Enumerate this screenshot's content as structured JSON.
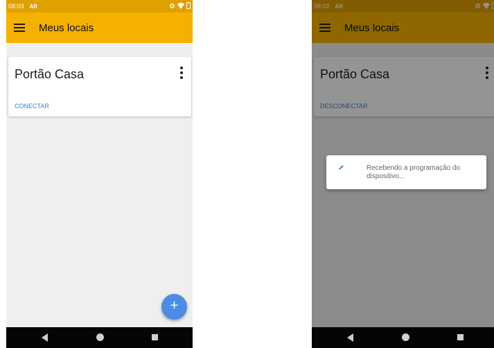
{
  "screens": {
    "left": {
      "status": {
        "time": "08:03",
        "notif": "AR"
      },
      "appbar": {
        "title": "Meus locais"
      },
      "card": {
        "name": "Portão Casa",
        "action": "CONECTAR"
      },
      "fab_label": "+"
    },
    "right": {
      "status": {
        "time": "08:02",
        "notif": "AR"
      },
      "appbar": {
        "title": "Meus locais"
      },
      "card": {
        "name": "Portão Casa",
        "action": "DESCONECTAR"
      },
      "dialog": {
        "message": "Recebendo a programação do dispositivo..."
      }
    }
  },
  "colors": {
    "appbar": "#f5b100",
    "statusbar": "#e0a100",
    "fab": "#4c8de3",
    "link": "#3a80c9"
  },
  "icons": [
    "menu-icon",
    "more-vert-icon",
    "add-icon",
    "nav-back-icon",
    "nav-home-icon",
    "nav-recents-icon",
    "spinner-icon"
  ]
}
